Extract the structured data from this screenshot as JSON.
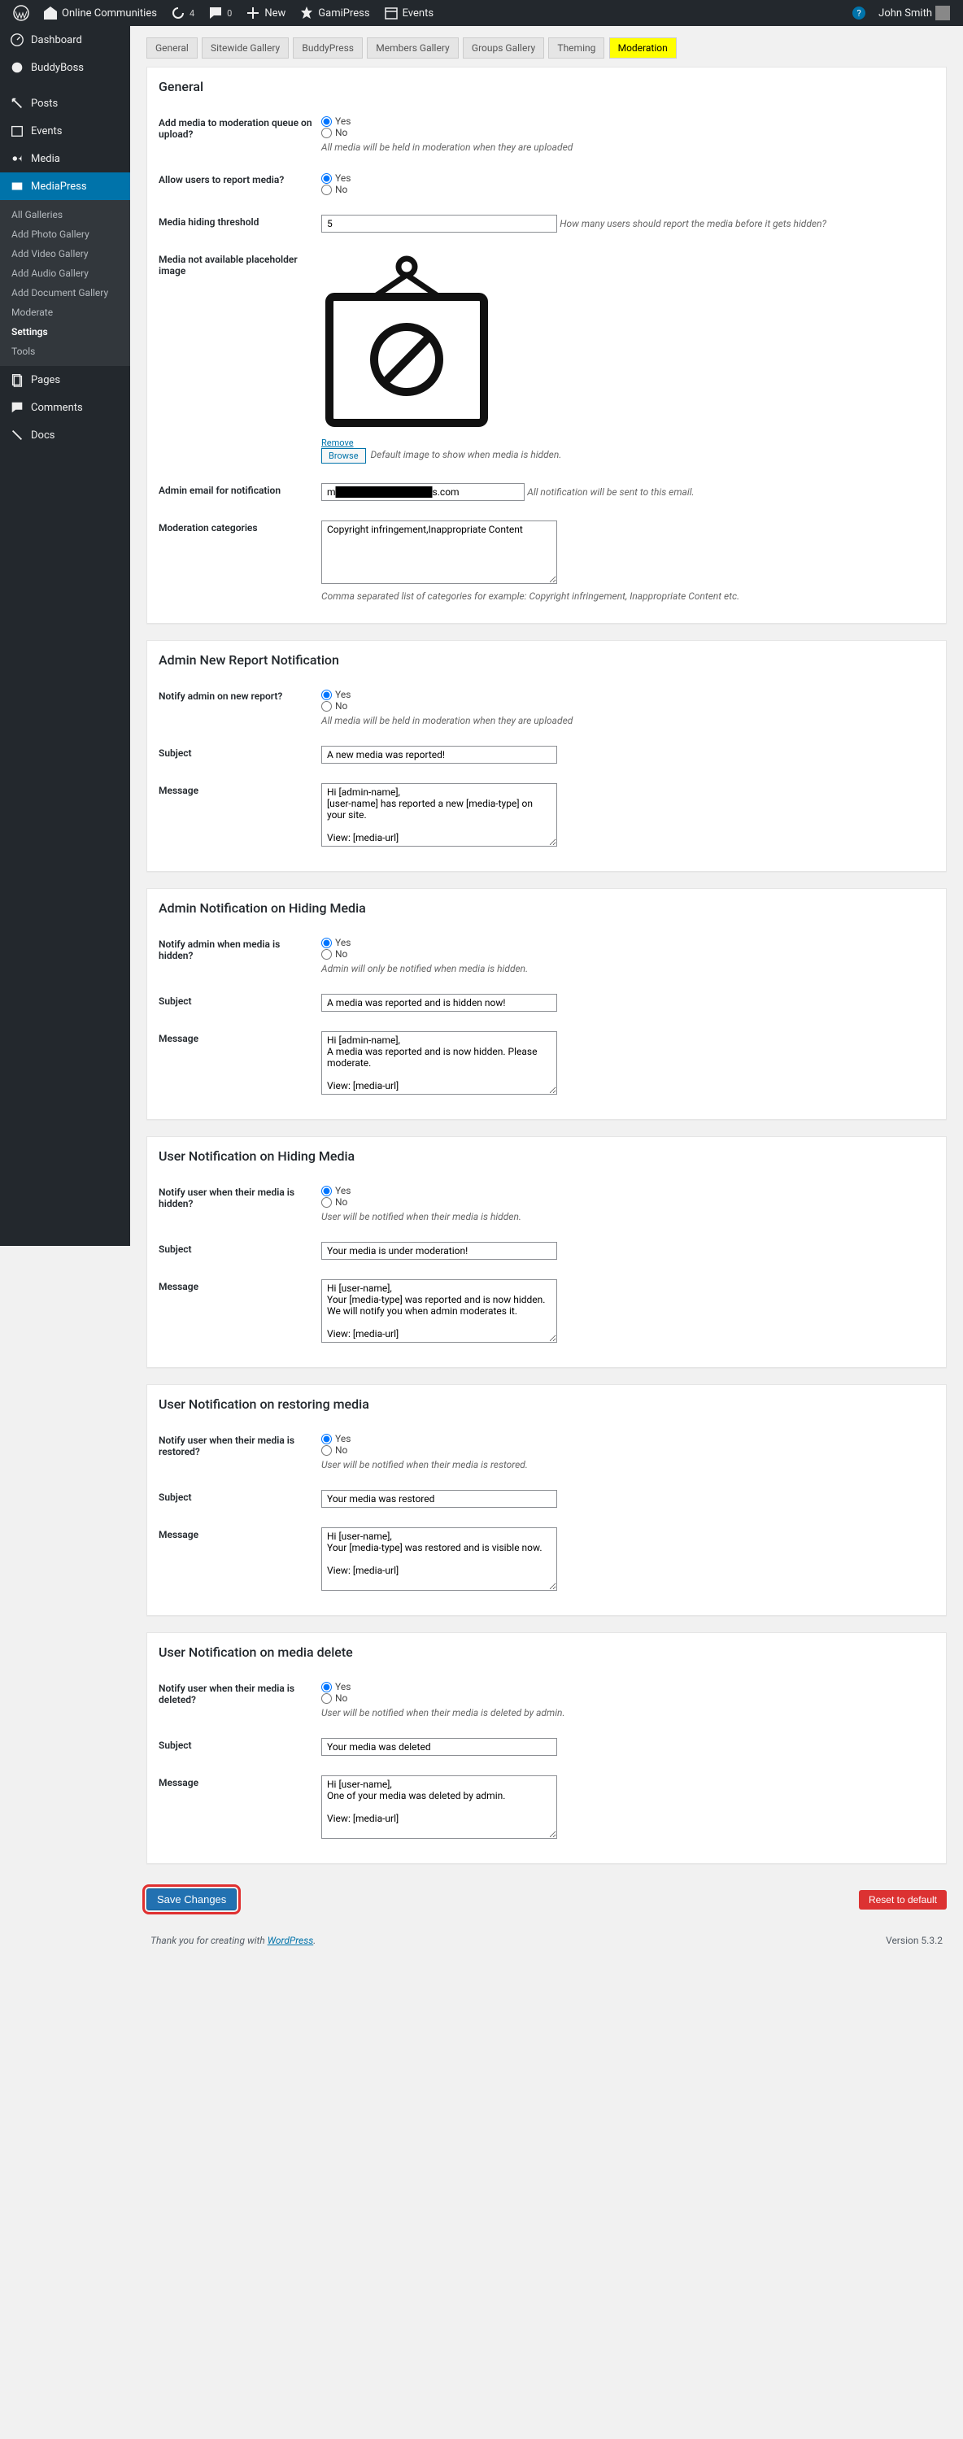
{
  "adminbar": {
    "site_name": "Online Communities",
    "updates": "4",
    "comments": "0",
    "new": "New",
    "gamipress": "GamiPress",
    "events": "Events",
    "howdy": "John Smith",
    "help": "?"
  },
  "menu": {
    "dashboard": "Dashboard",
    "buddyboss": "BuddyBoss",
    "posts": "Posts",
    "events": "Events",
    "media": "Media",
    "mediapress": "MediaPress",
    "pages": "Pages",
    "comments": "Comments",
    "docs": "Docs"
  },
  "submenu": {
    "all_galleries": "All Galleries",
    "add_photo": "Add Photo Gallery",
    "add_video": "Add Video Gallery",
    "add_audio": "Add Audio Gallery",
    "add_document": "Add Document Gallery",
    "moderate": "Moderate",
    "settings": "Settings",
    "tools": "Tools"
  },
  "tabs": {
    "general": "General",
    "sitewide": "Sitewide Gallery",
    "buddypress": "BuddyPress",
    "members": "Members Gallery",
    "groups": "Groups Gallery",
    "theming": "Theming",
    "moderation": "Moderation"
  },
  "yes": "Yes",
  "no": "No",
  "sections": {
    "general": {
      "title": "General",
      "add_media_label": "Add media to moderation queue on upload?",
      "add_media_desc": "All media will be held in moderation when they are uploaded",
      "allow_report_label": "Allow users to report media?",
      "threshold_label": "Media hiding threshold",
      "threshold_value": "5",
      "threshold_desc": "How many users should report the media before it gets hidden?",
      "placeholder_label": "Media not available placeholder image",
      "remove": "Remove",
      "browse": "Browse",
      "placeholder_desc": "Default image to show when media is hidden.",
      "admin_email_label": "Admin email for notification",
      "admin_email_value": "m██████████████s.com",
      "admin_email_desc": "All notification will be sent to this email.",
      "categories_label": "Moderation categories",
      "categories_value": "Copyright infringement,Inappropriate Content",
      "categories_desc": "Comma separated list of categories for example: Copyright infringement, Inappropriate Content etc."
    },
    "admin_new": {
      "title": "Admin New Report Notification",
      "notify_label": "Notify admin on new report?",
      "notify_desc": "All media will be held in moderation when they are uploaded",
      "subject_label": "Subject",
      "subject_value": "A new media was reported!",
      "message_label": "Message",
      "message_value": "Hi [admin-name],\n[user-name] has reported a new [media-type] on your site.\n\nView: [media-url]"
    },
    "admin_hide": {
      "title": "Admin Notification on Hiding Media",
      "notify_label": "Notify admin when media is hidden?",
      "notify_desc": "Admin will only be notified when media is hidden.",
      "subject_label": "Subject",
      "subject_value": "A media was reported and is hidden now!",
      "message_label": "Message",
      "message_value": "Hi [admin-name],\nA media was reported and is now hidden. Please moderate.\n\nView: [media-url]"
    },
    "user_hide": {
      "title": "User Notification on Hiding Media",
      "notify_label": "Notify user when their media is hidden?",
      "notify_desc": "User will be notified when their media is hidden.",
      "subject_label": "Subject",
      "subject_value": "Your media is under moderation!",
      "message_label": "Message",
      "message_value": "Hi [user-name],\nYour [media-type] was reported and is now hidden. We will notify you when admin moderates it.\n\nView: [media-url]"
    },
    "user_restore": {
      "title": "User Notification on restoring media",
      "notify_label": "Notify user when their media is restored?",
      "notify_desc": "User will be notified when their media is restored.",
      "subject_label": "Subject",
      "subject_value": "Your media was restored",
      "message_label": "Message",
      "message_value": "Hi [user-name],\nYour [media-type] was restored and is visible now.\n\nView: [media-url]"
    },
    "user_delete": {
      "title": "User Notification on media delete",
      "notify_label": "Notify user when their media is deleted?",
      "notify_desc": "User will be notified when their media is deleted by admin.",
      "subject_label": "Subject",
      "subject_value": "Your media was deleted",
      "message_label": "Message",
      "message_value": "Hi [user-name],\nOne of your media was deleted by admin.\n\nView: [media-url]"
    }
  },
  "save": "Save Changes",
  "reset": "Reset to default",
  "footer": {
    "thanks": "Thank you for creating with ",
    "wp": "WordPress",
    "period": ".",
    "version": "Version 5.3.2"
  }
}
